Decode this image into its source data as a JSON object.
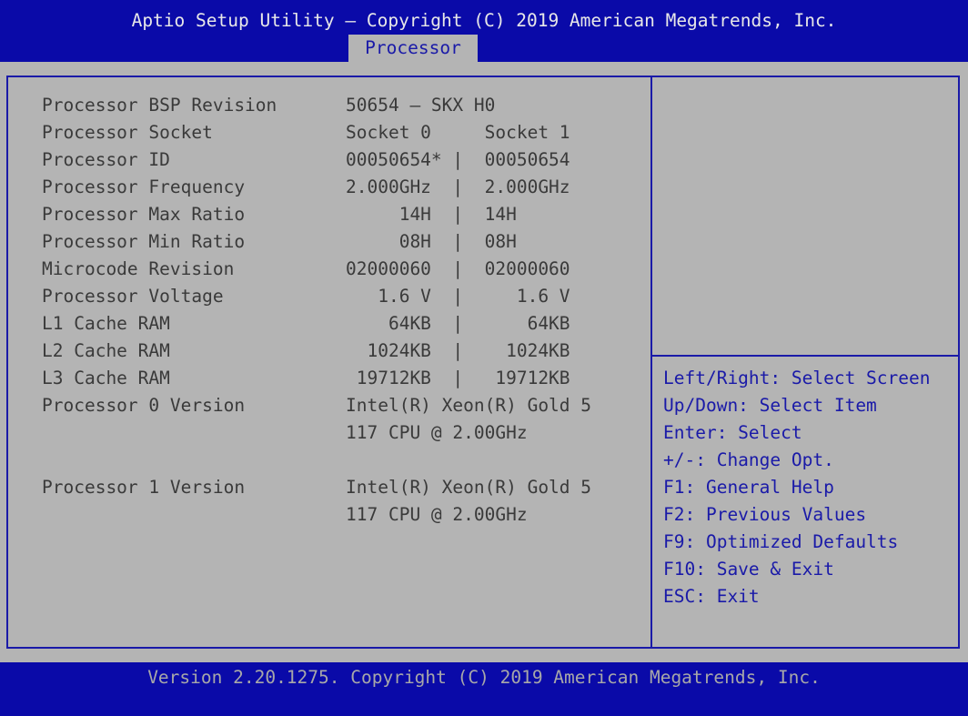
{
  "header": {
    "title": "Aptio Setup Utility – Copyright (C) 2019 American Megatrends, Inc.",
    "active_tab": "Processor"
  },
  "rows": [
    {
      "label": "Processor BSP Revision",
      "value": "50654 – SKX H0"
    },
    {
      "label": "Processor Socket",
      "value": "Socket 0     Socket 1"
    },
    {
      "label": "Processor ID",
      "value": "00050654* |  00050654"
    },
    {
      "label": "Processor Frequency",
      "value": "2.000GHz  |  2.000GHz"
    },
    {
      "label": "Processor Max Ratio",
      "value": "     14H  |  14H"
    },
    {
      "label": "Processor Min Ratio",
      "value": "     08H  |  08H"
    },
    {
      "label": "Microcode Revision",
      "value": "02000060  |  02000060"
    },
    {
      "label": "Processor Voltage",
      "value": "   1.6 V  |     1.6 V"
    },
    {
      "label": "L1 Cache RAM",
      "value": "    64KB  |      64KB"
    },
    {
      "label": "L2 Cache RAM",
      "value": "  1024KB  |    1024KB"
    },
    {
      "label": "L3 Cache RAM",
      "value": " 19712KB  |   19712KB"
    },
    {
      "label": "Processor 0 Version",
      "value": "Intel(R) Xeon(R) Gold 5"
    },
    {
      "label": "",
      "value": "117 CPU @ 2.00GHz"
    },
    {
      "label": "Processor 1 Version",
      "value": "Intel(R) Xeon(R) Gold 5"
    },
    {
      "label": "",
      "value": "117 CPU @ 2.00GHz"
    }
  ],
  "help": [
    "Left/Right: Select Screen",
    "Up/Down: Select Item",
    "Enter: Select",
    "+/-: Change Opt.",
    "F1: General Help",
    "F2: Previous Values",
    "F9: Optimized Defaults",
    "F10: Save & Exit",
    "ESC: Exit"
  ],
  "footer": {
    "version": "Version 2.20.1275. Copyright (C) 2019 American Megatrends, Inc."
  },
  "colors": {
    "header_bg": "#0a0aa8",
    "content_bg": "#b4b4b4",
    "accent_blue": "#1a1aa8",
    "text_gray": "#3a3a3a"
  }
}
